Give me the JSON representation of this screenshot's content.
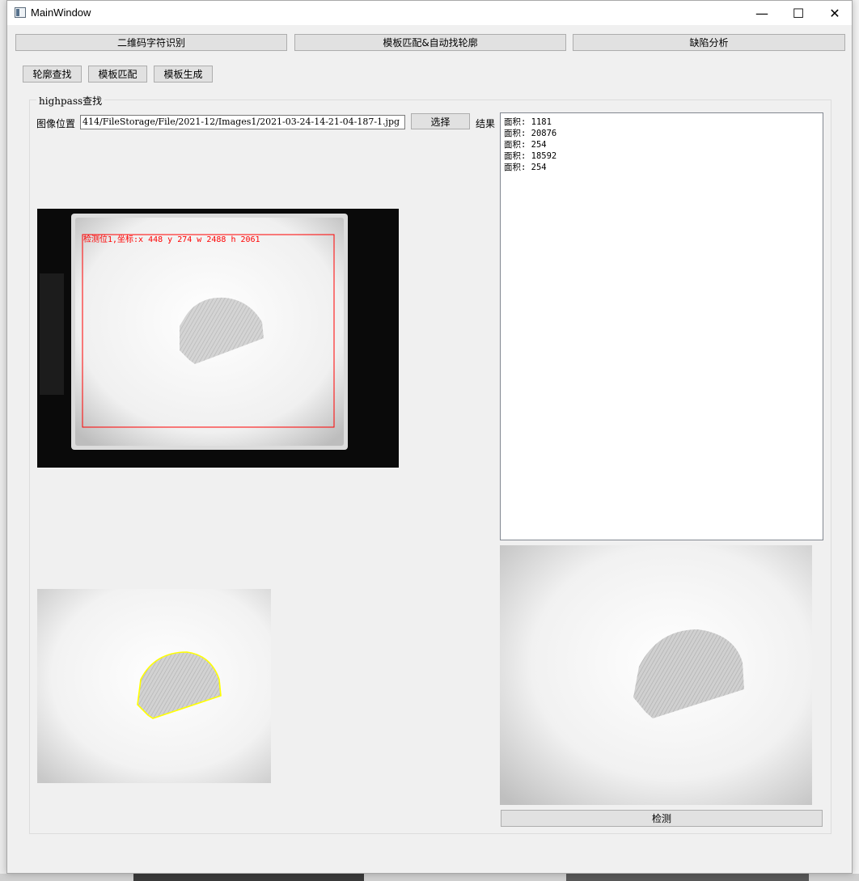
{
  "window": {
    "title": "MainWindow",
    "minimize_glyph": "—",
    "maximize_glyph": "☐",
    "close_glyph": "✕"
  },
  "main_tabs": [
    "二维码字符识别",
    "模板匹配&自动找轮廓",
    "缺陷分析"
  ],
  "sub_tabs": [
    "轮廓查找",
    "模板匹配",
    "模板生成"
  ],
  "group": {
    "title": "highpass查找"
  },
  "form": {
    "image_label": "图像位置",
    "image_path": "414/FileStorage/File/2021-12/Images1/2021-03-24-14-21-04-187-1.jpg",
    "select_button": "选择",
    "result_label": "结果",
    "detect_button": "检测"
  },
  "results": [
    "面积: 1181",
    "面积: 20876",
    "面积: 254",
    "面积: 18592",
    "面积: 254"
  ],
  "detection_overlay": {
    "text": "检测位1,坐标:x 448 y 274 w 2488 h 2061",
    "color": "#ff0000"
  },
  "contour_color": "#ffff00"
}
